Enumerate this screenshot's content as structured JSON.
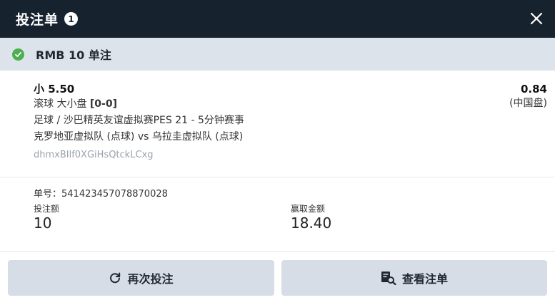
{
  "header": {
    "title": "投注单",
    "count": "1"
  },
  "status": {
    "text": "RMB 10 单注"
  },
  "bet": {
    "selection": "小 5.50",
    "market_prefix": "滚球 大小盘 ",
    "market_score": "[0-0]",
    "league": "足球 / 沙巴精英友谊虚拟赛PES 21 - 5分钟赛事",
    "match": "克罗地亚虚拟队 (点球) vs 乌拉圭虚拟队 (点球)",
    "code": "dhmxBIlf0XGiHsQtckLCxg",
    "odds": "0.84",
    "odds_type": "(中国盘)"
  },
  "info": {
    "ticket_no": "单号：541423457078870028",
    "stake_label": "投注额",
    "stake_value": "10",
    "win_label": "赢取金额",
    "win_value": "18.40"
  },
  "actions": {
    "rebet_label": "再次投注",
    "view_label": "查看注单"
  },
  "colors": {
    "header_bg": "#17222f",
    "status_bg": "#dde3ea",
    "success": "#4caf50",
    "button_bg": "#d6dde6"
  },
  "icons": {
    "close": "close-icon",
    "check": "check-circle-icon",
    "rebet": "refresh-icon",
    "view": "receipt-search-icon"
  }
}
